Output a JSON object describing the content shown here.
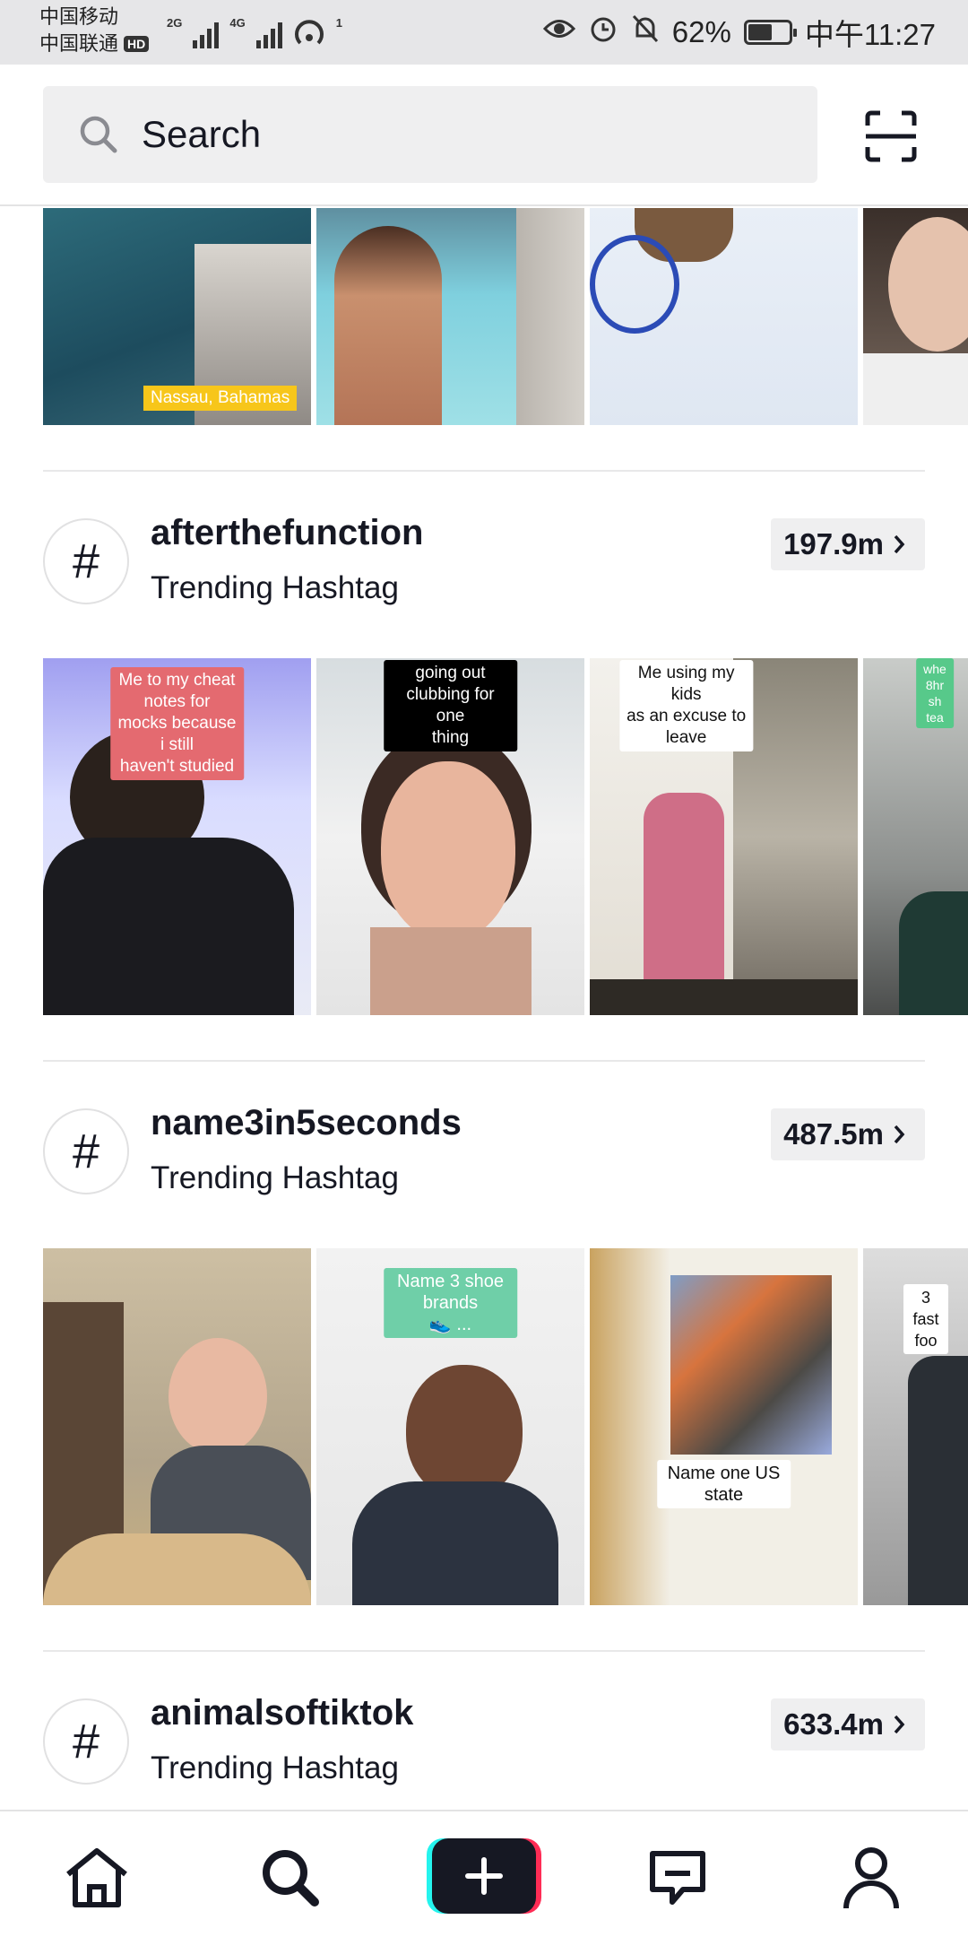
{
  "status_bar": {
    "carrier1": "中国移动",
    "carrier2": "中国联通",
    "hd": "HD",
    "net1": "2G",
    "net2": "4G",
    "hotspot_count": "1",
    "battery": "62%",
    "battery_level": 0.62,
    "time": "中午11:27"
  },
  "search": {
    "placeholder": "Search"
  },
  "top_row": {
    "location_label": "Nassau, Bahamas"
  },
  "hashtags": [
    {
      "title": "afterthefunction",
      "subtitle": "Trending Hashtag",
      "count": "197.9m",
      "captions": [
        "Me to my cheat notes for\nmocks because i still\nhaven't studied",
        "going out clubbing for one\nthing",
        "Me using my kids\nas an excuse to leave",
        "whe\n8hr sh\ntea"
      ]
    },
    {
      "title": "name3in5seconds",
      "subtitle": "Trending Hashtag",
      "count": "487.5m",
      "captions": [
        "",
        "Name 3 shoe brands\n👟 ...",
        "Name one US state",
        "3 fast foo"
      ]
    },
    {
      "title": "animalsoftiktok",
      "subtitle": "Trending Hashtag",
      "count": "633.4m"
    }
  ],
  "nav": {
    "items": [
      "home-icon",
      "discover-icon",
      "create-icon",
      "inbox-icon",
      "profile-icon"
    ]
  }
}
